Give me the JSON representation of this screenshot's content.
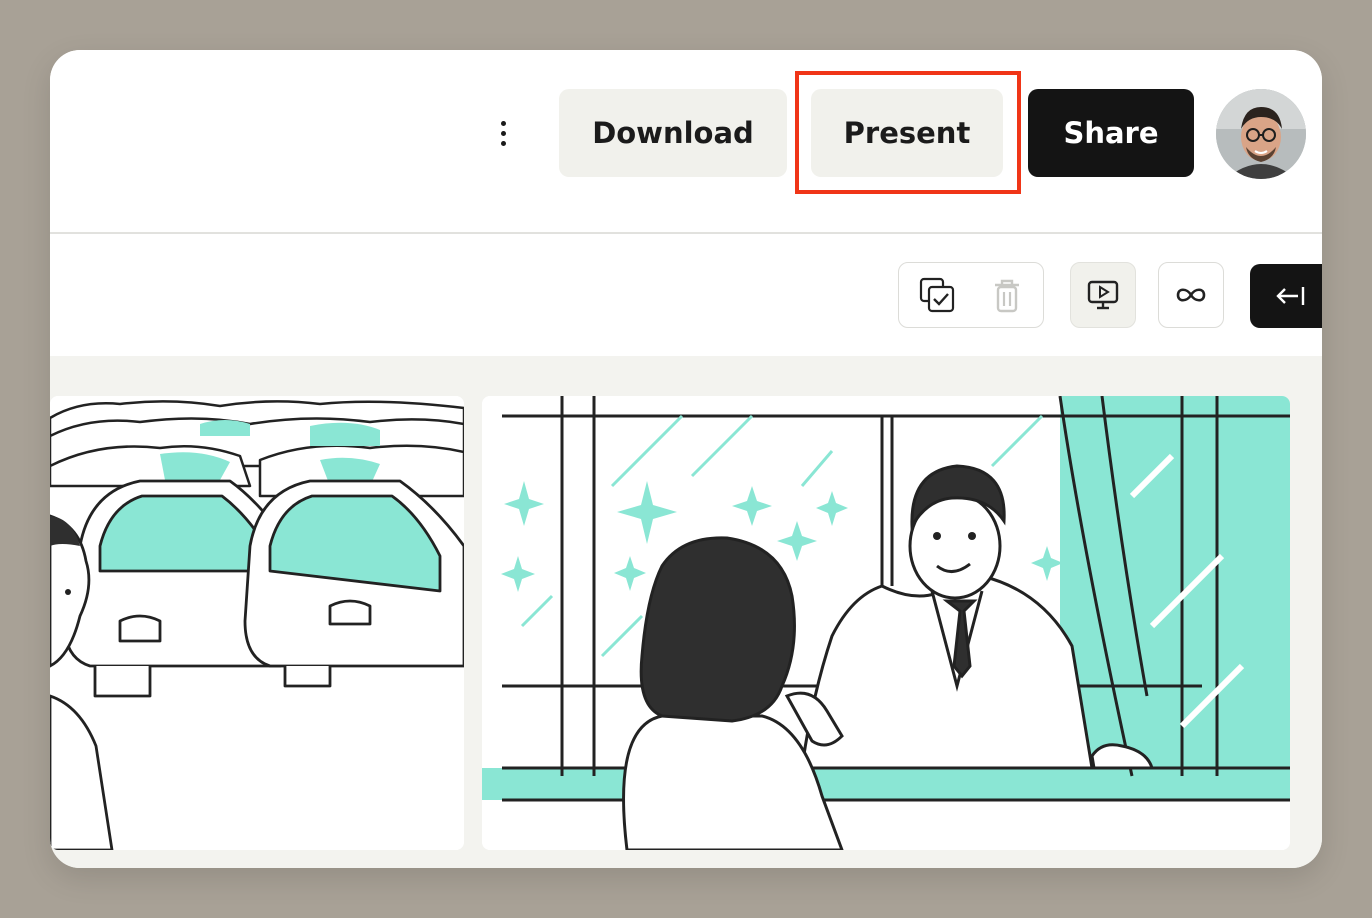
{
  "header": {
    "more_icon": "more-vertical-icon",
    "download_label": "Download",
    "present_label": "Present",
    "share_label": "Share",
    "avatar_icon": "user-avatar"
  },
  "toolbar": {
    "icons": [
      "duplicate-check-icon",
      "trash-icon",
      "present-screen-icon",
      "infinity-icon",
      "collapse-left-icon"
    ]
  },
  "gallery": {
    "images": [
      "parking-lot-illustration",
      "clinic-reception-illustration"
    ],
    "accent_color": "#8ae6d4"
  },
  "colors": {
    "highlight": "#f03517",
    "share_bg": "#141414",
    "backdrop": "#a8a196"
  }
}
